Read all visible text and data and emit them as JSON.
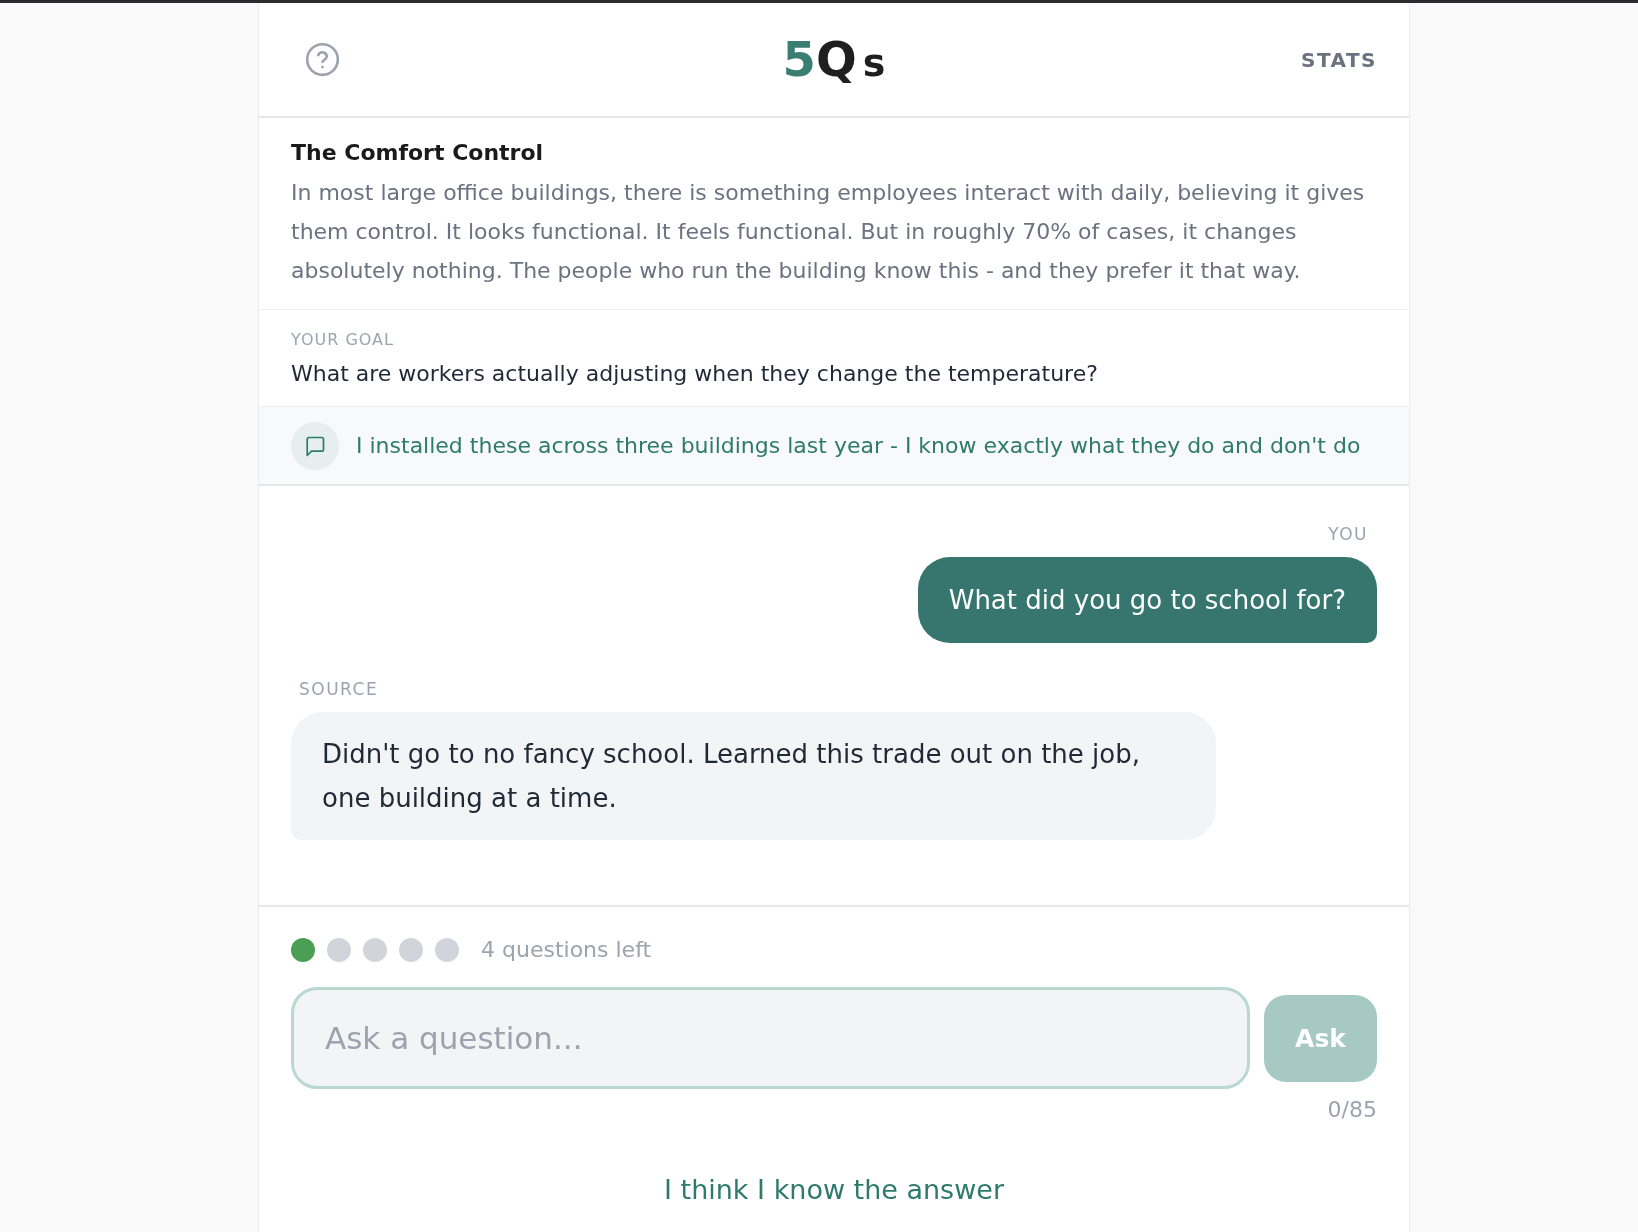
{
  "header": {
    "logo": [
      {
        "text": "5",
        "kind": "accent"
      },
      {
        "text": "Q",
        "kind": "main"
      },
      {
        "text": "s",
        "kind": "small"
      }
    ],
    "stats_link": "STATS"
  },
  "puzzle": {
    "title": "The Comfort Control",
    "description": "In most large office buildings, there is something employees interact with daily, believing it gives them control. It looks functional. It feels functional. But in roughly 70% of cases, it changes absolutely nothing. The people who run the building know this - and they prefer it that way."
  },
  "goal": {
    "label": "YOUR GOAL",
    "text": "What are workers actually adjusting when they change the temperature?"
  },
  "hint": {
    "text": "I installed these across three buildings last year - I know exactly what they do and don't do"
  },
  "messages": [
    {
      "kind": "user",
      "sender": "YOU",
      "text": "What did you go to school for?"
    },
    {
      "kind": "source",
      "sender": "SOURCE",
      "text": "Didn't go to no fancy school. Learned this trade out on the job, one building at a time."
    }
  ],
  "progress": {
    "dots": [
      {
        "used": true
      },
      {
        "used": false
      },
      {
        "used": false
      },
      {
        "used": false
      },
      {
        "used": false
      }
    ],
    "remaining_text": "4 questions left"
  },
  "question_input": {
    "placeholder": "Ask a question..."
  },
  "ask_button": {
    "label": "Ask",
    "disabled": true
  },
  "char_count": "0/85",
  "answer_link": "I think I know the answer"
}
